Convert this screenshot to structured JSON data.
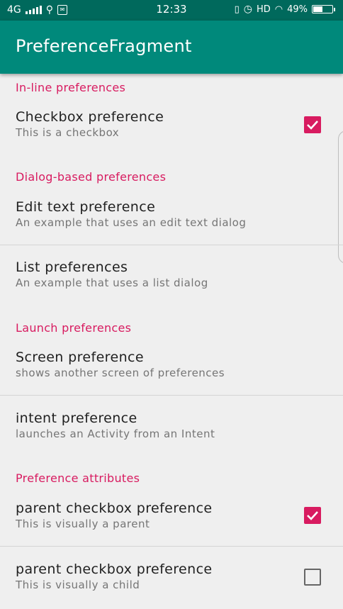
{
  "status_bar": {
    "network": "4G",
    "time": "12:33",
    "hd": "HD",
    "battery": "49%"
  },
  "app_bar": {
    "title": "PreferenceFragment"
  },
  "sections": {
    "inline": {
      "header": "In-line preferences",
      "checkbox": {
        "title": "Checkbox preference",
        "summary": "This is a checkbox",
        "checked": true
      }
    },
    "dialog": {
      "header": "Dialog-based preferences",
      "edit_text": {
        "title": "Edit text preference",
        "summary": "An example that uses an edit text dialog"
      },
      "list": {
        "title": "List preferences",
        "summary": "An example that uses a list dialog"
      }
    },
    "launch": {
      "header": "Launch preferences",
      "screen": {
        "title": "Screen preference",
        "summary": "shows another screen of preferences"
      },
      "intent": {
        "title": "intent preference",
        "summary": "launches an Activity from an Intent"
      }
    },
    "attributes": {
      "header": "Preference attributes",
      "parent": {
        "title": "parent checkbox preference",
        "summary": "This is visually a parent",
        "checked": true
      },
      "child": {
        "title": "parent checkbox preference",
        "summary": "This is visually a child",
        "checked": false
      }
    }
  },
  "colors": {
    "status_bar": "#00695c",
    "app_bar": "#00897b",
    "accent": "#d81b60"
  },
  "icons": [
    "usb-icon",
    "signal-icon",
    "vibrate-icon",
    "alarm-icon",
    "wifi-icon",
    "battery-icon"
  ]
}
